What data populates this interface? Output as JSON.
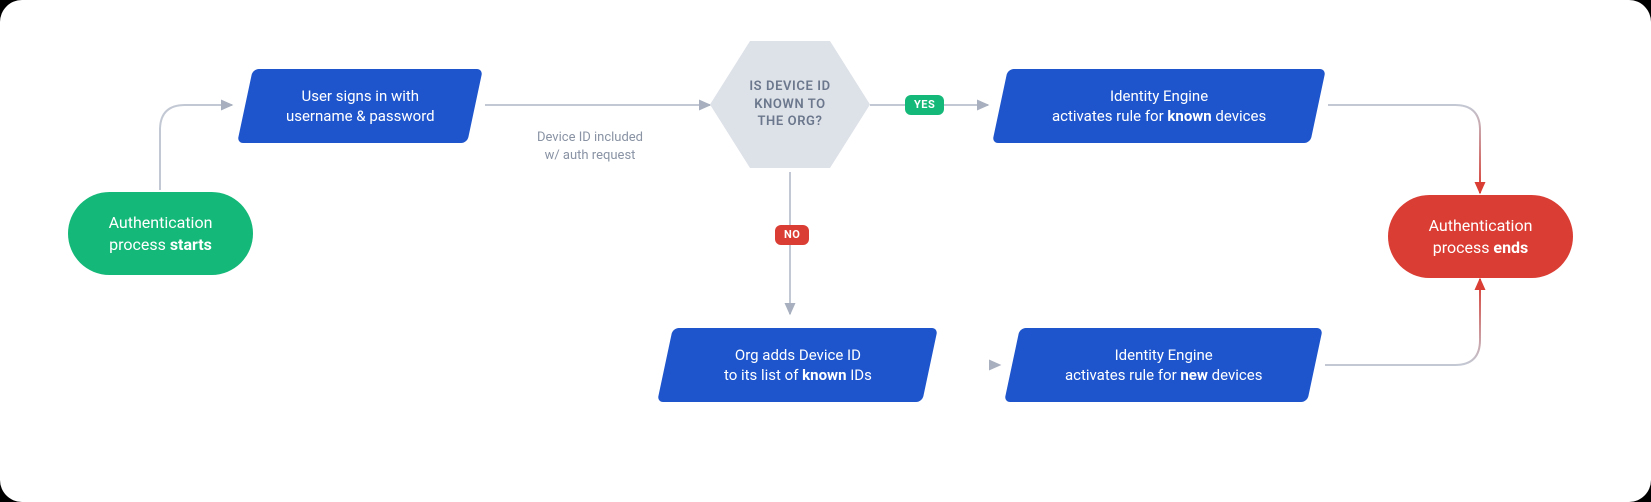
{
  "start": {
    "line1": "Authentication",
    "line2_prefix": "process ",
    "line2_bold": "starts"
  },
  "step_signin": {
    "line1": "User signs in with",
    "line2": "username & password"
  },
  "note": {
    "line1": "Device ID included",
    "line2": "w/ auth request"
  },
  "decision": {
    "line1": "IS DEVICE ID",
    "line2": "KNOWN TO",
    "line3": "THE ORG?"
  },
  "badge_yes": "YES",
  "badge_no": "NO",
  "step_known": {
    "line1": "Identity Engine",
    "line2_prefix": "activates rule for ",
    "line2_bold": "known",
    "line2_suffix": " devices"
  },
  "step_add": {
    "line1": "Org adds Device ID",
    "line2_prefix": "to its list of ",
    "line2_bold": "known",
    "line2_suffix": " IDs"
  },
  "step_new": {
    "line1": "Identity Engine",
    "line2_prefix": "activates rule for ",
    "line2_bold": "new",
    "line2_suffix": " devices"
  },
  "end": {
    "line1": "Authentication",
    "line2_prefix": "process ",
    "line2_bold": "ends"
  },
  "colors": {
    "green": "#14b878",
    "blue": "#1e55cc",
    "red": "#da3d33",
    "hex_bg": "#dde1e8",
    "connector": "#c3c9d4"
  }
}
